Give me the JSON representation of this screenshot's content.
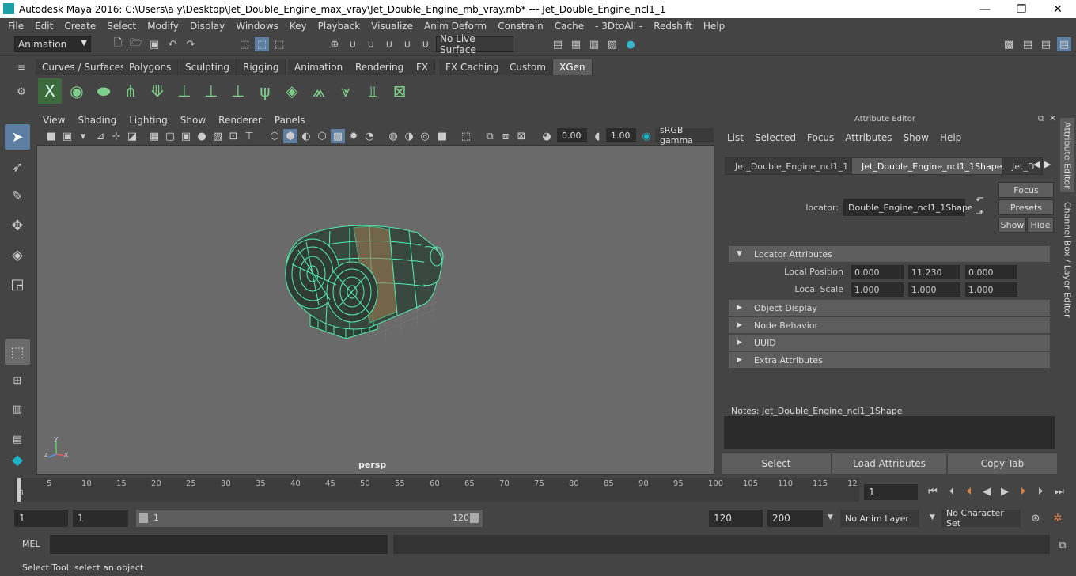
{
  "window": {
    "title": "Autodesk Maya 2016: C:\\Users\\a y\\Desktop\\Jet_Double_Engine_max_vray\\Jet_Double_Engine_mb_vray.mb*   ---   Jet_Double_Engine_ncl1_1",
    "minimize": "—",
    "maximize": "❐",
    "close": "✕"
  },
  "menubar": [
    "File",
    "Edit",
    "Create",
    "Select",
    "Modify",
    "Display",
    "Windows",
    "Key",
    "Playback",
    "Visualize",
    "Anim Deform",
    "Constrain",
    "Cache",
    "- 3DtoAll -",
    "Redshift",
    "Help"
  ],
  "statusline": {
    "menuset": "Animation",
    "live_surface": "No Live Surface"
  },
  "shelf_tabs": [
    "Curves / Surfaces",
    "Polygons",
    "Sculpting",
    "Rigging",
    "Animation",
    "Rendering",
    "FX",
    "FX Caching",
    "Custom",
    "XGen"
  ],
  "active_shelf_tab": "XGen",
  "panel_menu": [
    "View",
    "Shading",
    "Lighting",
    "Show",
    "Renderer",
    "Panels"
  ],
  "panel_toolbar": {
    "exposure": "0.00",
    "gamma": "1.00",
    "colorspace": "sRGB gamma"
  },
  "viewport": {
    "camera_label": "persp",
    "axis_y": "y",
    "axis_z": "z",
    "axis_x": "x"
  },
  "attribute_editor": {
    "header": "Attribute Editor",
    "menu": [
      "List",
      "Selected",
      "Focus",
      "Attributes",
      "Show",
      "Help"
    ],
    "tabs": [
      "Jet_Double_Engine_ncl1_1",
      "Jet_Double_Engine_ncl1_1Shape",
      "Jet_D"
    ],
    "active_tab": "Jet_Double_Engine_ncl1_1Shape",
    "node_label": "locator:",
    "node_value": "Double_Engine_ncl1_1Shape",
    "btn_focus": "Focus",
    "btn_presets": "Presets",
    "btn_show": "Show",
    "btn_hide": "Hide",
    "sections": {
      "locator": "Locator Attributes",
      "object_display": "Object Display",
      "node_behavior": "Node Behavior",
      "uuid": "UUID",
      "extra": "Extra Attributes"
    },
    "local_position_label": "Local Position",
    "local_position": [
      "0.000",
      "11.230",
      "0.000"
    ],
    "local_scale_label": "Local Scale",
    "local_scale": [
      "1.000",
      "1.000",
      "1.000"
    ],
    "notes_label": "Notes:  Jet_Double_Engine_ncl1_1Shape",
    "btn_select": "Select",
    "btn_load": "Load Attributes",
    "btn_copy": "Copy Tab"
  },
  "side_tabs": [
    "Attribute Editor",
    "Channel Box / Layer Editor"
  ],
  "timeline": {
    "ticks": [
      "1",
      "5",
      "10",
      "15",
      "20",
      "25",
      "30",
      "35",
      "40",
      "45",
      "50",
      "55",
      "60",
      "65",
      "70",
      "75",
      "80",
      "85",
      "90",
      "95",
      "100",
      "105",
      "110",
      "115",
      "12"
    ],
    "current_frame": "1"
  },
  "range": {
    "start": "1",
    "playback_start": "1",
    "slider_start": "1",
    "slider_end": "120",
    "playback_end": "120",
    "end": "200",
    "anim_layer": "No Anim Layer",
    "character_set": "No Character Set"
  },
  "mel_label": "MEL",
  "help_line": "Select Tool: select an object"
}
